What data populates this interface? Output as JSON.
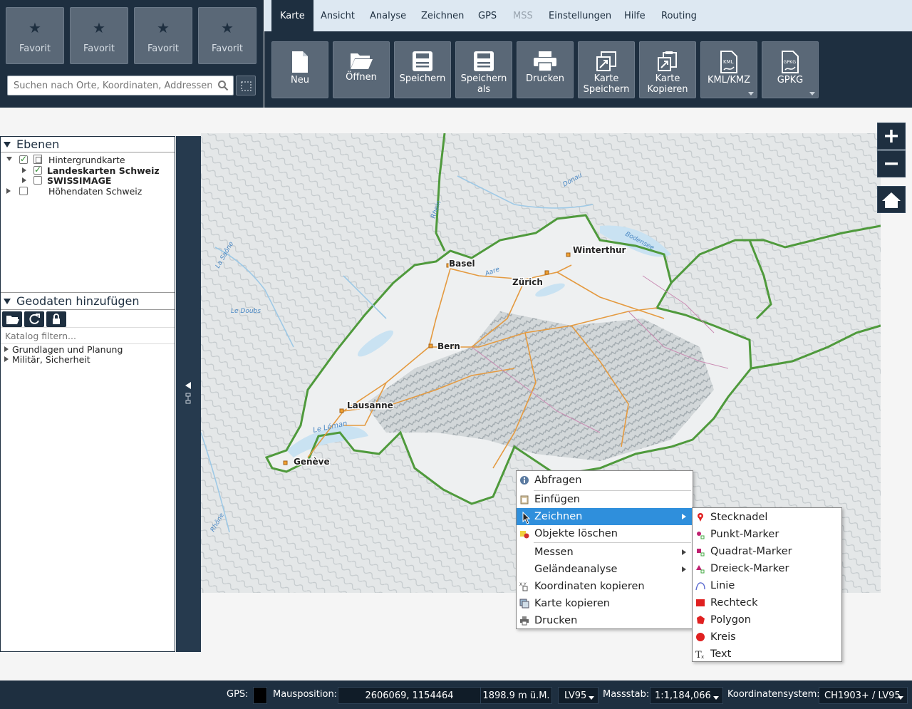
{
  "favorites": [
    {
      "label": "Favorit"
    },
    {
      "label": "Favorit"
    },
    {
      "label": "Favorit"
    },
    {
      "label": "Favorit"
    }
  ],
  "search": {
    "placeholder": "Suchen nach Orte, Koordinaten, Addressen, ..."
  },
  "menu_tabs": [
    {
      "label": "Karte",
      "active": true
    },
    {
      "label": "Ansicht"
    },
    {
      "label": "Analyse"
    },
    {
      "label": "Zeichnen"
    },
    {
      "label": "GPS"
    },
    {
      "label": "MSS",
      "disabled": true
    },
    {
      "label": "Einstellungen"
    },
    {
      "label": "Hilfe"
    },
    {
      "label": "Routing"
    }
  ],
  "ribbon_buttons": [
    {
      "label": "Neu",
      "icon": "new-file-icon"
    },
    {
      "label": "Öffnen",
      "icon": "folder-open-icon"
    },
    {
      "label": "Speichern",
      "icon": "save-icon"
    },
    {
      "label": "Speichern als",
      "icon": "save-as-icon"
    },
    {
      "label": "Drucken",
      "icon": "printer-icon"
    },
    {
      "label": "Karte Speichern",
      "icon": "map-save-icon"
    },
    {
      "label": "Karte Kopieren",
      "icon": "map-copy-icon"
    },
    {
      "label": "KML/KMZ",
      "icon": "kml-file-icon"
    },
    {
      "label": "GPKG",
      "icon": "gpkg-file-icon"
    }
  ],
  "layers": {
    "title": "Ebenen",
    "items": [
      {
        "label": "Hintergrundkarte",
        "checked": true
      },
      {
        "label": "Landeskarten Schweiz",
        "checked": true,
        "bold": true
      },
      {
        "label": "SWISSIMAGE",
        "checked": false,
        "bold": true
      },
      {
        "label": "Höhendaten Schweiz",
        "checked": false
      }
    ]
  },
  "geodata": {
    "title": "Geodaten hinzufügen",
    "filter_placeholder": "Katalog filtern...",
    "items": [
      {
        "label": "Grundlagen und Planung"
      },
      {
        "label": "Militär, Sicherheit"
      }
    ]
  },
  "map": {
    "cities": [
      "Basel",
      "Winterthur",
      "Zürich",
      "Bern",
      "Lausanne",
      "Genève"
    ],
    "water": [
      "Le Léman",
      "Bodensee",
      "Rhein",
      "Aare",
      "Le Doubs",
      "La Saône",
      "Donau",
      "Rhône"
    ]
  },
  "context_menu": {
    "items": [
      {
        "label": "Abfragen",
        "icon": "info-query-icon"
      },
      {
        "label": "Einfügen",
        "icon": "paste-icon"
      },
      {
        "label": "Zeichnen",
        "icon": "",
        "submenu": true,
        "highlighted": true
      },
      {
        "label": "Objekte löschen",
        "icon": "delete-objects-icon"
      },
      {
        "label": "Messen",
        "submenu": true
      },
      {
        "label": "Geländeanalyse",
        "submenu": true
      },
      {
        "label": "Koordinaten kopieren",
        "icon": "copy-coordinates-icon"
      },
      {
        "label": "Karte kopieren",
        "icon": "copy-map-icon"
      },
      {
        "label": "Drucken",
        "icon": "printer-icon"
      }
    ]
  },
  "draw_submenu": {
    "items": [
      {
        "label": "Stecknadel",
        "icon": "pin-icon"
      },
      {
        "label": "Punkt-Marker",
        "icon": "point-marker-icon"
      },
      {
        "label": "Quadrat-Marker",
        "icon": "square-marker-icon"
      },
      {
        "label": "Dreieck-Marker",
        "icon": "triangle-marker-icon"
      },
      {
        "label": "Linie",
        "icon": "line-icon"
      },
      {
        "label": "Rechteck",
        "icon": "rectangle-icon"
      },
      {
        "label": "Polygon",
        "icon": "polygon-icon"
      },
      {
        "label": "Kreis",
        "icon": "circle-icon"
      },
      {
        "label": "Text",
        "icon": "text-icon"
      }
    ]
  },
  "status": {
    "gps_label": "GPS:",
    "mouse_label": "Mausposition:",
    "coords": "2606069, 1154464",
    "elevation": "1898.9 m ü.M.",
    "height_system": "LV95",
    "scale_label": "Massstab:",
    "scale": "1:1,184,066",
    "crs_label": "Koordinatensystem:",
    "crs": "CH1903+ / LV95"
  },
  "colors": {
    "dark_panel": "#1e2f40",
    "tab_bar": "#dde8f2",
    "menu_highlight": "#2f8fdc",
    "border_green": "#4f9a3c"
  }
}
